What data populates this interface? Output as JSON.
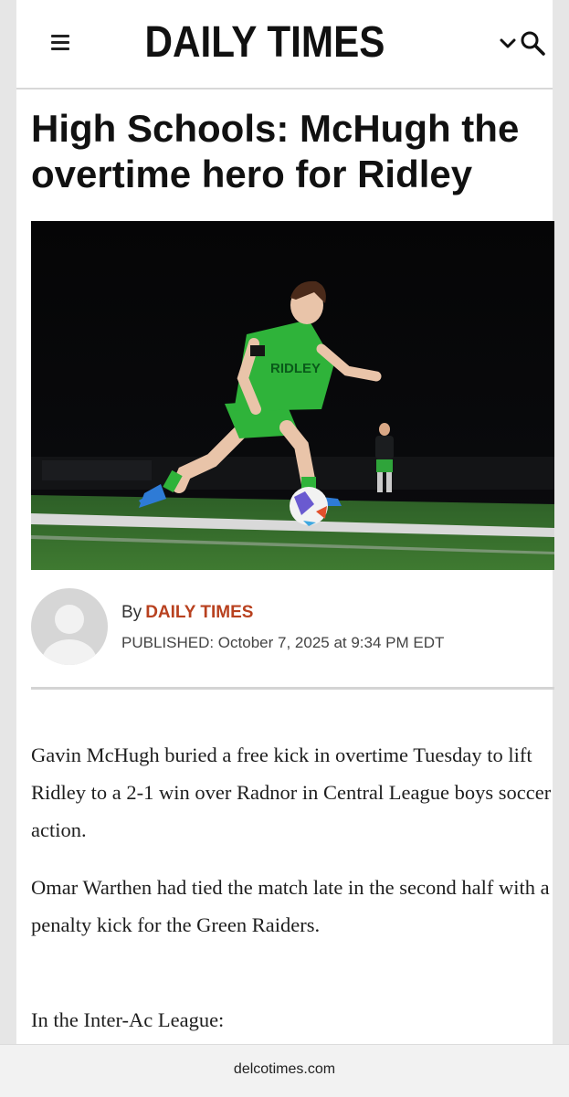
{
  "header": {
    "brand": "DAILY TIMES",
    "menu_icon": "hamburger-menu-icon",
    "chevron_icon": "chevron-down-icon",
    "search_icon": "search-icon"
  },
  "article": {
    "headline": "High Schools: McHugh the overtime hero for Ridley",
    "image": {
      "kind": "photo",
      "jersey_text": "RIDLEY"
    },
    "byline_prefix": "By",
    "author": "DAILY TIMES",
    "published": "PUBLISHED: October 7, 2025 at 9:34 PM EDT",
    "paragraphs": [
      "Gavin McHugh buried a free kick in overtime Tuesday to lift Ridley to a 2-1 win over Radnor in Central League boys soccer action.",
      "Omar Warthen had tied the match late in the second half with a penalty kick for the Green Raiders.",
      "In the Inter-Ac League:"
    ]
  },
  "footer": {
    "url": "delcotimes.com"
  },
  "colors": {
    "author_accent": "#b8411f",
    "jersey_green": "#2fb33a",
    "field_green": "#2f6d2a"
  }
}
